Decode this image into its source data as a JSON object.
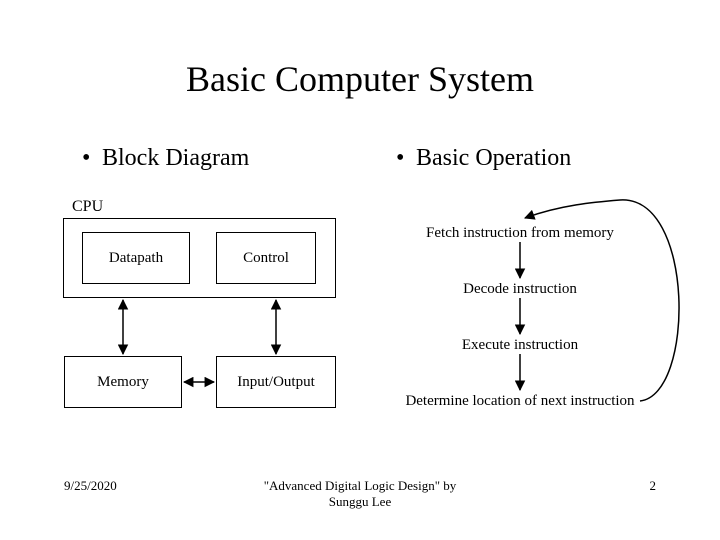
{
  "title": "Basic Computer System",
  "columns": {
    "left_label": "Block Diagram",
    "right_label": "Basic Operation"
  },
  "block_diagram": {
    "cpu_label": "CPU",
    "datapath": "Datapath",
    "control": "Control",
    "memory": "Memory",
    "io": "Input/Output"
  },
  "operation_steps": {
    "s1": "Fetch instruction from memory",
    "s2": "Decode instruction",
    "s3": "Execute instruction",
    "s4": "Determine location of next instruction"
  },
  "footer": {
    "date": "9/25/2020",
    "source_line1": "\"Advanced Digital Logic Design\" by",
    "source_line2": "Sunggu Lee",
    "page": "2"
  }
}
